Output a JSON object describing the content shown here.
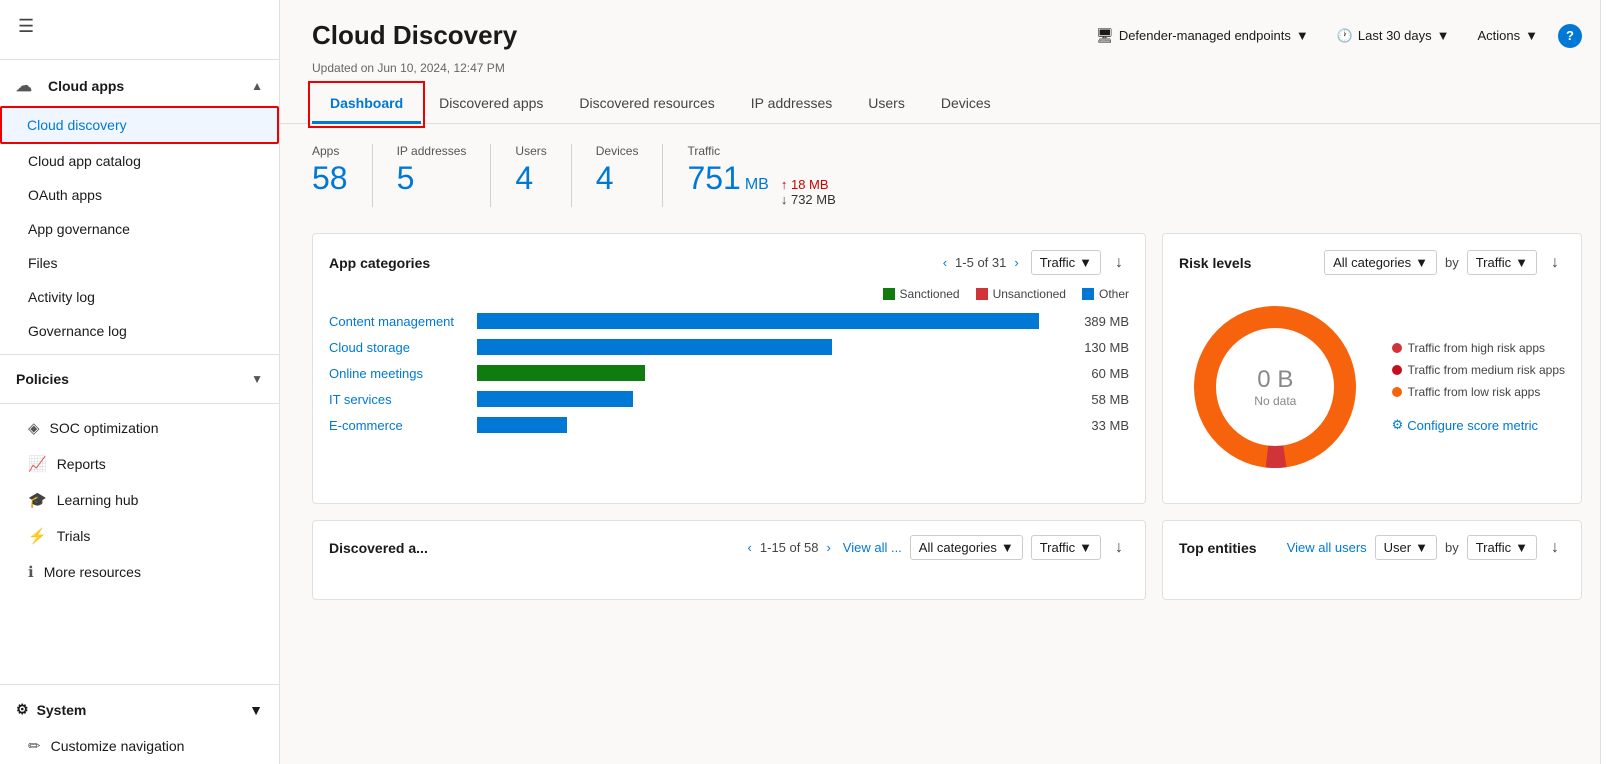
{
  "sidebar": {
    "hamburger_icon": "☰",
    "sections": [
      {
        "id": "cloud-apps",
        "label": "Cloud apps",
        "icon": "☁",
        "chevron": "▲",
        "expanded": true,
        "items": [
          {
            "id": "cloud-discovery",
            "label": "Cloud discovery",
            "active": true
          },
          {
            "id": "cloud-app-catalog",
            "label": "Cloud app catalog",
            "active": false
          },
          {
            "id": "oauth-apps",
            "label": "OAuth apps",
            "active": false
          },
          {
            "id": "app-governance",
            "label": "App governance",
            "active": false
          },
          {
            "id": "files",
            "label": "Files",
            "active": false
          },
          {
            "id": "activity-log",
            "label": "Activity log",
            "active": false
          },
          {
            "id": "governance-log",
            "label": "Governance log",
            "active": false
          }
        ]
      },
      {
        "id": "policies",
        "label": "Policies",
        "icon": "",
        "chevron": "▼",
        "expanded": false,
        "items": []
      }
    ],
    "standalone_items": [
      {
        "id": "soc-optimization",
        "label": "SOC optimization",
        "icon": "◈"
      },
      {
        "id": "reports",
        "label": "Reports",
        "icon": "📈"
      },
      {
        "id": "learning-hub",
        "label": "Learning hub",
        "icon": "🎓"
      },
      {
        "id": "trials",
        "label": "Trials",
        "icon": "⚡"
      },
      {
        "id": "more-resources",
        "label": "More resources",
        "icon": "ℹ"
      }
    ],
    "bottom_items": [
      {
        "id": "system",
        "label": "System",
        "icon": "⚙",
        "chevron": "▼"
      },
      {
        "id": "customize-navigation",
        "label": "Customize navigation",
        "icon": "✏"
      }
    ]
  },
  "header": {
    "title": "Cloud Discovery",
    "endpoint_label": "Defender-managed endpoints",
    "timerange_label": "Last 30 days",
    "actions_label": "Actions",
    "updated_text": "Updated on Jun 10, 2024, 12:47 PM"
  },
  "tabs": [
    {
      "id": "dashboard",
      "label": "Dashboard",
      "active": true
    },
    {
      "id": "discovered-apps",
      "label": "Discovered apps",
      "active": false
    },
    {
      "id": "discovered-resources",
      "label": "Discovered resources",
      "active": false
    },
    {
      "id": "ip-addresses",
      "label": "IP addresses",
      "active": false
    },
    {
      "id": "users",
      "label": "Users",
      "active": false
    },
    {
      "id": "devices",
      "label": "Devices",
      "active": false
    }
  ],
  "stats": {
    "apps": {
      "label": "Apps",
      "value": "58"
    },
    "ip_addresses": {
      "label": "IP addresses",
      "value": "5"
    },
    "users": {
      "label": "Users",
      "value": "4"
    },
    "devices": {
      "label": "Devices",
      "value": "4"
    },
    "traffic": {
      "label": "Traffic",
      "value": "751",
      "unit": "MB",
      "upload": "18 MB",
      "download": "732 MB"
    }
  },
  "app_categories": {
    "title": "App categories",
    "pagination": "1-5 of 31",
    "filter": "Traffic",
    "legend": [
      {
        "id": "sanctioned",
        "label": "Sanctioned",
        "color": "#107c10"
      },
      {
        "id": "unsanctioned",
        "label": "Unsanctioned",
        "color": "#d13438"
      },
      {
        "id": "other",
        "label": "Other",
        "color": "#0078d4"
      }
    ],
    "bars": [
      {
        "label": "Content management",
        "value": "389 MB",
        "width_pct": 95,
        "segments": [
          {
            "color": "#0078d4",
            "pct": 95
          }
        ]
      },
      {
        "label": "Cloud storage",
        "value": "130 MB",
        "width_pct": 60,
        "segments": [
          {
            "color": "#0078d4",
            "pct": 58
          },
          {
            "color": "#0078d4",
            "pct": 2
          }
        ]
      },
      {
        "label": "Online meetings",
        "value": "60 MB",
        "width_pct": 28,
        "segments": [
          {
            "color": "#107c10",
            "pct": 28
          }
        ]
      },
      {
        "label": "IT services",
        "value": "58 MB",
        "width_pct": 26,
        "segments": [
          {
            "color": "#0078d4",
            "pct": 26
          }
        ]
      },
      {
        "label": "E-commerce",
        "value": "33 MB",
        "width_pct": 15,
        "segments": [
          {
            "color": "#0078d4",
            "pct": 15
          }
        ]
      }
    ]
  },
  "risk_levels": {
    "title": "Risk levels",
    "categories_label": "All categories",
    "by_label": "by",
    "filter": "Traffic",
    "donut": {
      "value": "0 B",
      "label": "No data"
    },
    "legend": [
      {
        "id": "high-risk",
        "label": "Traffic from high risk apps",
        "color": "#d13438"
      },
      {
        "id": "medium-risk",
        "label": "Traffic from medium risk apps",
        "color": "#c50f1f"
      },
      {
        "id": "low-risk",
        "label": "Traffic from low risk apps",
        "color": "#f7630c"
      }
    ],
    "configure_link": "Configure score metric"
  },
  "discovered_apps": {
    "title": "Discovered a...",
    "pagination": "1-15 of 58",
    "view_all": "View all ...",
    "categories_label": "All categories",
    "filter": "Traffic"
  },
  "top_entities": {
    "title": "Top entities",
    "view_all": "View all users",
    "user_label": "User",
    "by_label": "by",
    "filter": "Traffic"
  }
}
